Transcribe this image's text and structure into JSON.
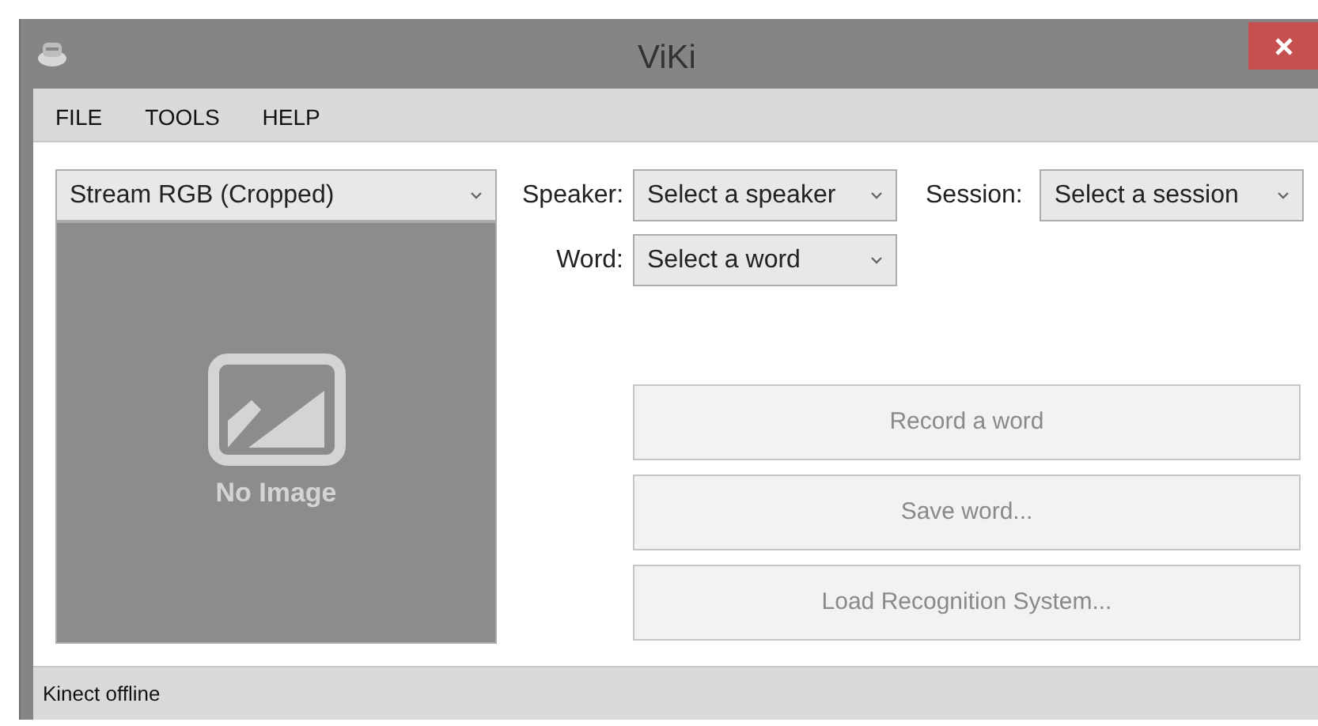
{
  "window": {
    "title": "ViKi"
  },
  "menu": [
    "FILE",
    "TOOLS",
    "HELP"
  ],
  "stream_select": {
    "value": "Stream RGB (Cropped)"
  },
  "preview": {
    "caption": "No Image"
  },
  "speaker": {
    "label": "Speaker:",
    "value": "Select a speaker"
  },
  "session": {
    "label": "Session:",
    "value": "Select a session"
  },
  "word": {
    "label": "Word:",
    "value": "Select a word"
  },
  "buttons": [
    {
      "label": "Record a word",
      "disabled": true
    },
    {
      "label": "Save word...",
      "disabled": true
    },
    {
      "label": "Load Recognition System...",
      "disabled": true
    }
  ],
  "status_bar": "Kinect offline"
}
